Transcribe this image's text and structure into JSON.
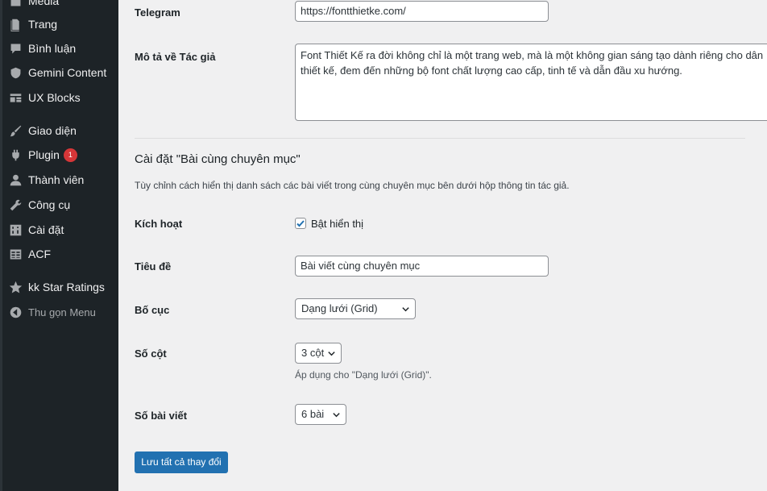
{
  "sidebar": {
    "items": [
      {
        "label": "Media",
        "icon": "media-icon"
      },
      {
        "label": "Trang",
        "icon": "page-icon"
      },
      {
        "label": "Bình luận",
        "icon": "comment-icon"
      },
      {
        "label": "Gemini Content",
        "icon": "shield-icon"
      },
      {
        "label": "UX Blocks",
        "icon": "blocks-icon"
      },
      {
        "label": "Giao diện",
        "icon": "brush-icon"
      },
      {
        "label": "Plugin",
        "icon": "plugin-icon",
        "badge": "1"
      },
      {
        "label": "Thành viên",
        "icon": "user-icon"
      },
      {
        "label": "Công cụ",
        "icon": "wrench-icon"
      },
      {
        "label": "Cài đặt",
        "icon": "settings-icon"
      },
      {
        "label": "ACF",
        "icon": "table-icon"
      },
      {
        "label": "kk Star Ratings",
        "icon": "star-icon"
      },
      {
        "label": "Thu gọn Menu",
        "icon": "collapse-icon"
      }
    ],
    "colors": {
      "background": "#1d2327",
      "text": "#f0f0f1",
      "icon": "#a7aaad",
      "badge": "#d63638"
    }
  },
  "form": {
    "telegram": {
      "label": "Telegram",
      "value": "https://fontthietke.com/"
    },
    "author_desc": {
      "label": "Mô tả về Tác giả",
      "value": "Font Thiết Kế ra đời không chỉ là một trang web, mà là một không gian sáng tạo dành riêng cho dân thiết kế, đem đến những bộ font chất lượng cao cấp, tinh tế và dẫn đầu xu hướng."
    },
    "section": {
      "title": "Cài đặt \"Bài cùng chuyên mục\"",
      "description": "Tùy chỉnh cách hiển thị danh sách các bài viết trong cùng chuyên mục bên dưới hộp thông tin tác giả."
    },
    "activate": {
      "label": "Kích hoạt",
      "checkbox_label": "Bật hiển thị",
      "checked": true
    },
    "heading": {
      "label": "Tiêu đề",
      "value": "Bài viết cùng chuyên mục"
    },
    "layout": {
      "label": "Bố cục",
      "value": "Dạng lưới (Grid)"
    },
    "columns": {
      "label": "Số cột",
      "value": "3 cột",
      "hint": "Áp dụng cho \"Dạng lưới (Grid)\"."
    },
    "post_count": {
      "label": "Số bài viết",
      "value": "6 bài"
    },
    "save_button": "Lưu tất cả thay đổi"
  },
  "colors": {
    "primary": "#2271b1",
    "page_bg": "#f0f0f1"
  }
}
